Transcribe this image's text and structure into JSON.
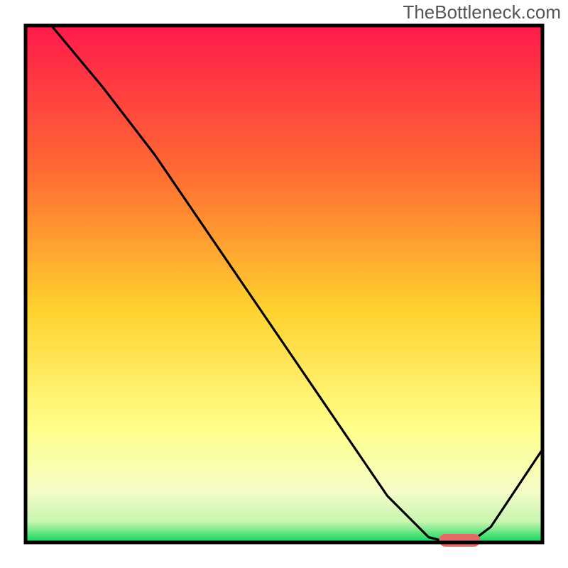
{
  "watermark": "TheBottleneck.com",
  "chart_data": {
    "type": "line",
    "title": "",
    "xlabel": "",
    "ylabel": "",
    "xlim": [
      0,
      100
    ],
    "ylim": [
      0,
      100
    ],
    "series": [
      {
        "name": "curve",
        "x": [
          5,
          15,
          25,
          40,
          55,
          70,
          78,
          82,
          86,
          90,
          100
        ],
        "y": [
          100,
          88,
          75,
          53,
          31,
          9,
          1,
          0,
          0,
          3,
          18
        ]
      }
    ],
    "marker": {
      "name": "optimal-region",
      "x": [
        80,
        88
      ],
      "y": 0
    },
    "gradient_bg": {
      "top": "#ff1a4b",
      "upper_mid": "#ff8b2e",
      "mid": "#ffd22e",
      "lower_mid": "#ffff8a",
      "low_band": "#f5fcc7",
      "bottom": "#0bd659"
    }
  }
}
